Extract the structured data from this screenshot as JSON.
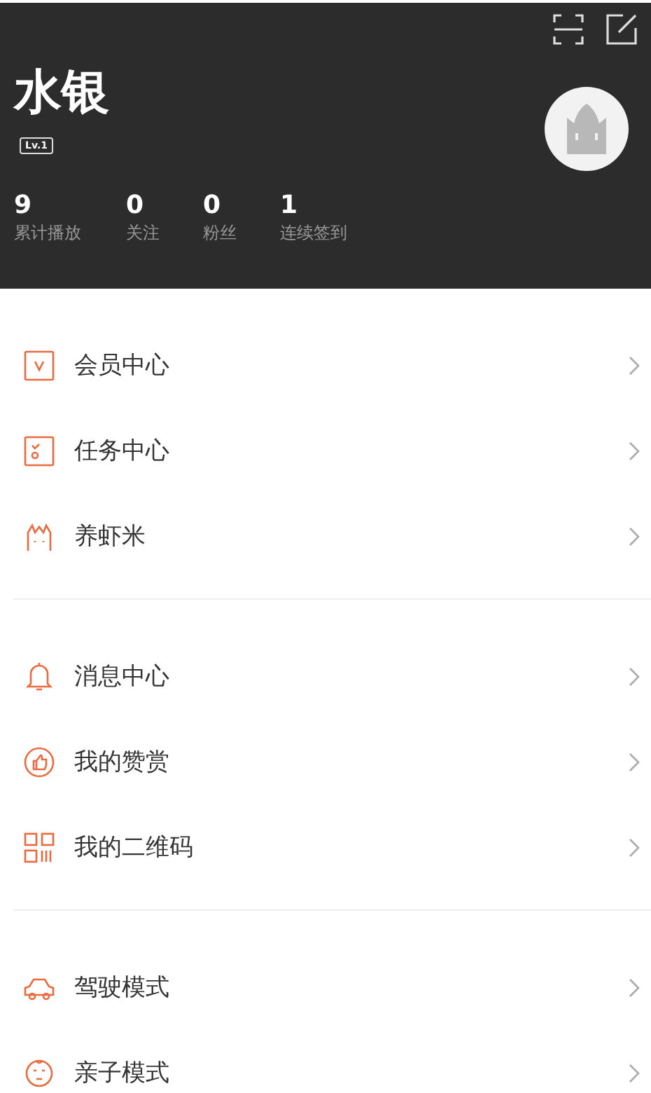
{
  "profile": {
    "name": "水银",
    "level": "Lv.1"
  },
  "stats": [
    {
      "value": "9",
      "label": "累计播放"
    },
    {
      "value": "0",
      "label": "关注"
    },
    {
      "value": "0",
      "label": "粉丝"
    },
    {
      "value": "1",
      "label": "连续签到"
    }
  ],
  "menu_groups": [
    [
      {
        "kind": "vip",
        "label": "会员中心"
      },
      {
        "kind": "task",
        "label": "任务中心"
      },
      {
        "kind": "pet",
        "label": "养虾米"
      }
    ],
    [
      {
        "kind": "bell",
        "label": "消息中心"
      },
      {
        "kind": "thumb",
        "label": "我的赞赏"
      },
      {
        "kind": "qr",
        "label": "我的二维码"
      }
    ],
    [
      {
        "kind": "car",
        "label": "驾驶模式"
      },
      {
        "kind": "baby",
        "label": "亲子模式"
      }
    ]
  ]
}
